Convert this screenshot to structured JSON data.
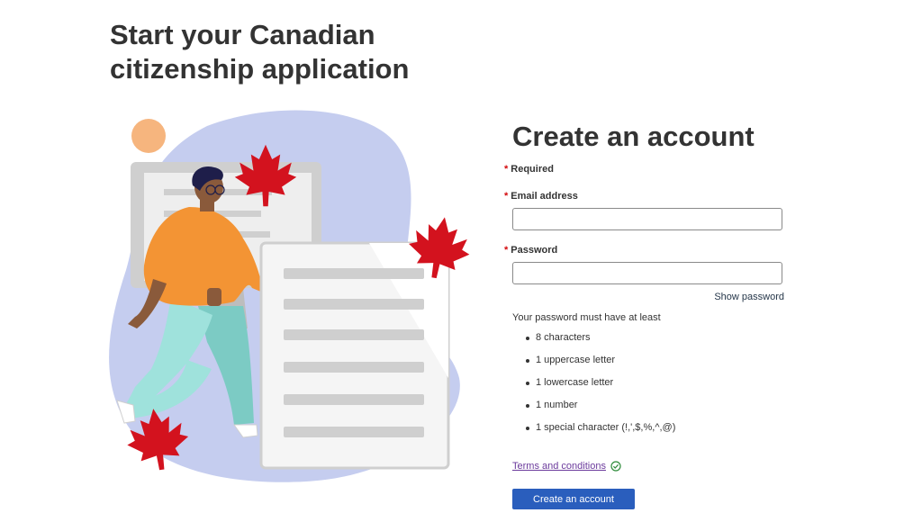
{
  "page": {
    "title": "Start your Canadian citizenship application"
  },
  "form": {
    "title": "Create an account",
    "required_note": "Required",
    "required_marker": "*",
    "email_label": "Email address",
    "email_value": "",
    "password_label": "Password",
    "password_value": "",
    "show_password": "Show password",
    "password_intro": "Your password must have at least",
    "password_rules": [
      "8 characters",
      "1 uppercase letter",
      "1 lowercase letter",
      "1 number",
      "1 special character (!,',$,%,^,@)"
    ],
    "terms_link": "Terms and conditions",
    "terms_icon": "check-circle-icon",
    "submit_label": "Create an account"
  },
  "colors": {
    "accent_button": "#2a5ebd",
    "required_star": "#d3080c",
    "link_visited": "#6b3a9c",
    "link": "#26374a",
    "check": "#2e8b3a",
    "maple_leaf": "#d3121e",
    "blob": "#c5cdef",
    "sun": "#f6b57e",
    "shirt": "#f39434",
    "pants": "#9fe2dc"
  }
}
